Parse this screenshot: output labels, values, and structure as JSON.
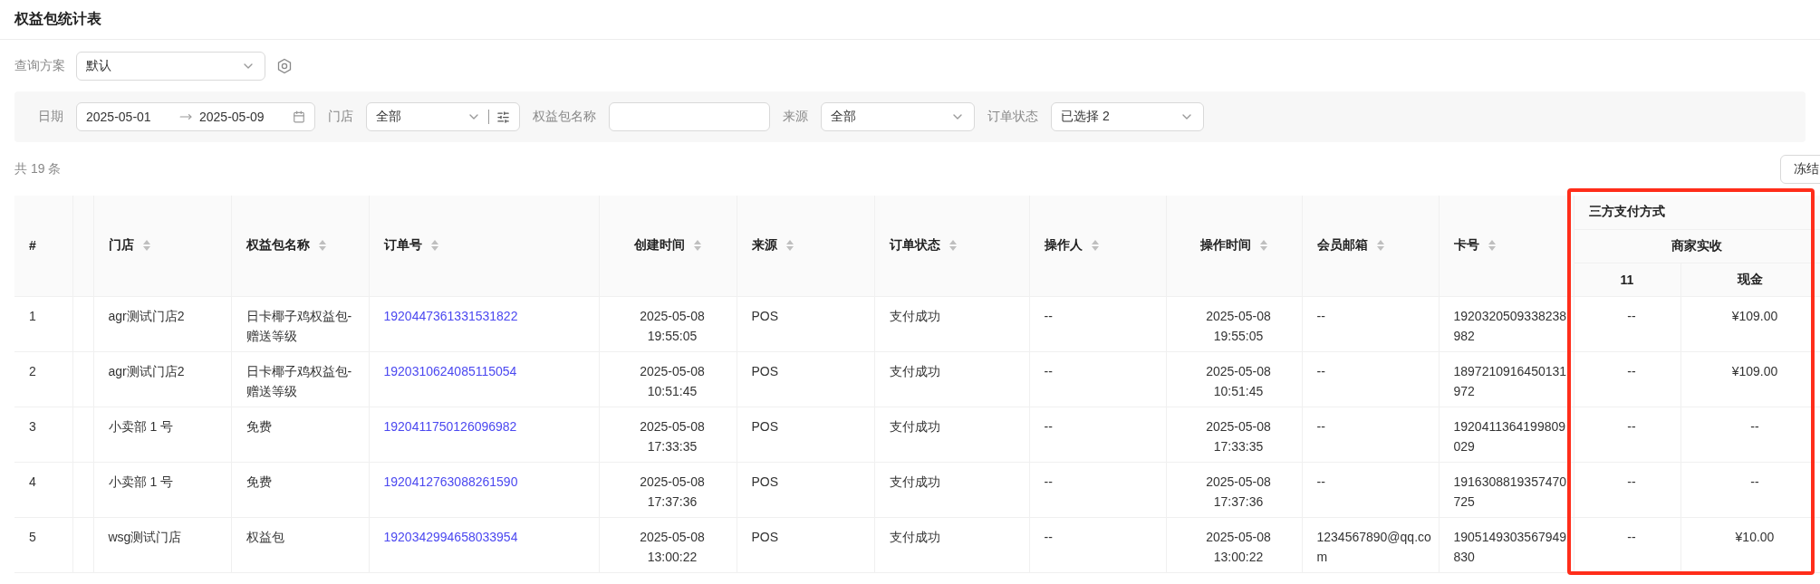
{
  "page_title": "权益包统计表",
  "query_scheme": {
    "label": "查询方案",
    "value": "默认"
  },
  "filters": [
    {
      "kind": "date_range",
      "label": "日期",
      "start": "2025-05-01",
      "end": "2025-05-09"
    },
    {
      "kind": "select",
      "label": "门店",
      "value": "全部",
      "filter_button": true
    },
    {
      "kind": "input",
      "label": "权益包名称"
    },
    {
      "kind": "select",
      "label": "来源",
      "value": "全部"
    },
    {
      "kind": "select",
      "label": "订单状态",
      "value": "已选择 2"
    }
  ],
  "total": "共 19 条",
  "freeze_button": "冻结",
  "table": {
    "columns": [
      {
        "label": "#",
        "sortable": false,
        "kind": "text"
      },
      {
        "label": "门店",
        "sortable": true,
        "kind": "text"
      },
      {
        "label": "权益包名称",
        "sortable": true,
        "kind": "text"
      },
      {
        "label": "订单号",
        "sortable": true,
        "kind": "link"
      },
      {
        "label": "创建时间",
        "sortable": true,
        "kind": "datetime"
      },
      {
        "label": "来源",
        "sortable": true,
        "kind": "text"
      },
      {
        "label": "订单状态",
        "sortable": true,
        "kind": "text"
      },
      {
        "label": "操作人",
        "sortable": true,
        "kind": "text"
      },
      {
        "label": "操作时间",
        "sortable": true,
        "kind": "datetime"
      },
      {
        "label": "会员邮箱",
        "sortable": true,
        "kind": "text"
      },
      {
        "label": "卡号",
        "sortable": true,
        "kind": "text"
      }
    ],
    "group": {
      "title": "三方支付方式",
      "subtitle": "商家实收",
      "columns": [
        "11",
        "现金"
      ],
      "highlighted": true
    },
    "rows": [
      {
        "cells": [
          "1",
          "agr测试门店2",
          "日卡椰子鸡权益包-赠送等级",
          "1920447361331531822",
          "2025-05-08 19:55:05",
          "POS",
          "支付成功",
          "--",
          "2025-05-08 19:55:05",
          "--",
          "1920320509338238982",
          "--",
          "¥109.00"
        ]
      },
      {
        "cells": [
          "2",
          "agr测试门店2",
          "日卡椰子鸡权益包-赠送等级",
          "1920310624085115054",
          "2025-05-08 10:51:45",
          "POS",
          "支付成功",
          "--",
          "2025-05-08 10:51:45",
          "--",
          "1897210916450131972",
          "--",
          "¥109.00"
        ]
      },
      {
        "cells": [
          "3",
          "小卖部 1 号",
          "免费",
          "1920411750126096982",
          "2025-05-08 17:33:35",
          "POS",
          "支付成功",
          "--",
          "2025-05-08 17:33:35",
          "--",
          "1920411364199809029",
          "--",
          "--"
        ]
      },
      {
        "cells": [
          "4",
          "小卖部 1 号",
          "免费",
          "1920412763088261590",
          "2025-05-08 17:37:36",
          "POS",
          "支付成功",
          "--",
          "2025-05-08 17:37:36",
          "--",
          "1916308819357470725",
          "--",
          "--"
        ]
      },
      {
        "cells": [
          "5",
          "wsg测试门店",
          "权益包",
          "1920342994658033954",
          "2025-05-08 13:00:22",
          "POS",
          "支付成功",
          "--",
          "2025-05-08 13:00:22",
          "1234567890@qq.com",
          "1905149303567949830",
          "--",
          "¥10.00"
        ]
      }
    ]
  }
}
